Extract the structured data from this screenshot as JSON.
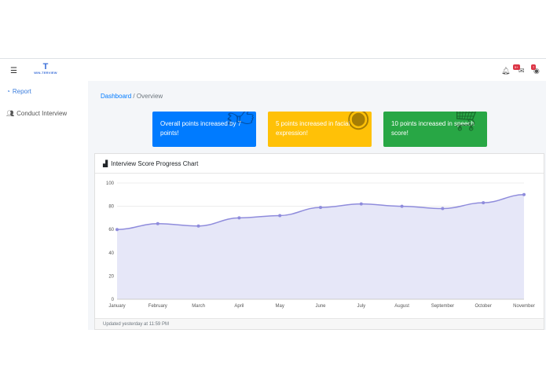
{
  "nav": {
    "logo_text": "WIN-TERVIEW",
    "messages_badge": "9+",
    "user_badge": "7"
  },
  "sidebar": {
    "items": [
      {
        "label": "Report",
        "icon": "tachometer-icon",
        "active": true
      },
      {
        "label": "Conduct Interview",
        "icon": "users-icon"
      }
    ]
  },
  "breadcrumb": {
    "root": "Dashboard",
    "sep": "/",
    "current": "Overview"
  },
  "info_boxes": [
    {
      "text": "Overall points increased by 7 points!",
      "color": "#007bff",
      "icon": "thumbs-up-icon"
    },
    {
      "text": "5 points increased in facial expression!",
      "color": "#ffc107",
      "icon": "eye-icon"
    },
    {
      "text": "10 points increased in speech score!",
      "color": "#28a745",
      "icon": "shopping-cart-icon"
    }
  ],
  "card": {
    "title": "Interview Score Progress Chart",
    "footer": "Updated yesterday at 11:59 PM"
  },
  "chart_data": {
    "type": "area",
    "categories": [
      "January",
      "February",
      "March",
      "April",
      "May",
      "June",
      "July",
      "August",
      "September",
      "October",
      "November"
    ],
    "values": [
      60,
      65,
      63,
      70,
      72,
      79,
      82,
      80,
      78,
      83,
      90
    ],
    "ylim": [
      0,
      100
    ],
    "yticks": [
      0,
      20,
      40,
      60,
      80,
      100
    ],
    "grid": true,
    "line_color": "#8f8cdc",
    "fill_color": "#e6e7f8"
  }
}
